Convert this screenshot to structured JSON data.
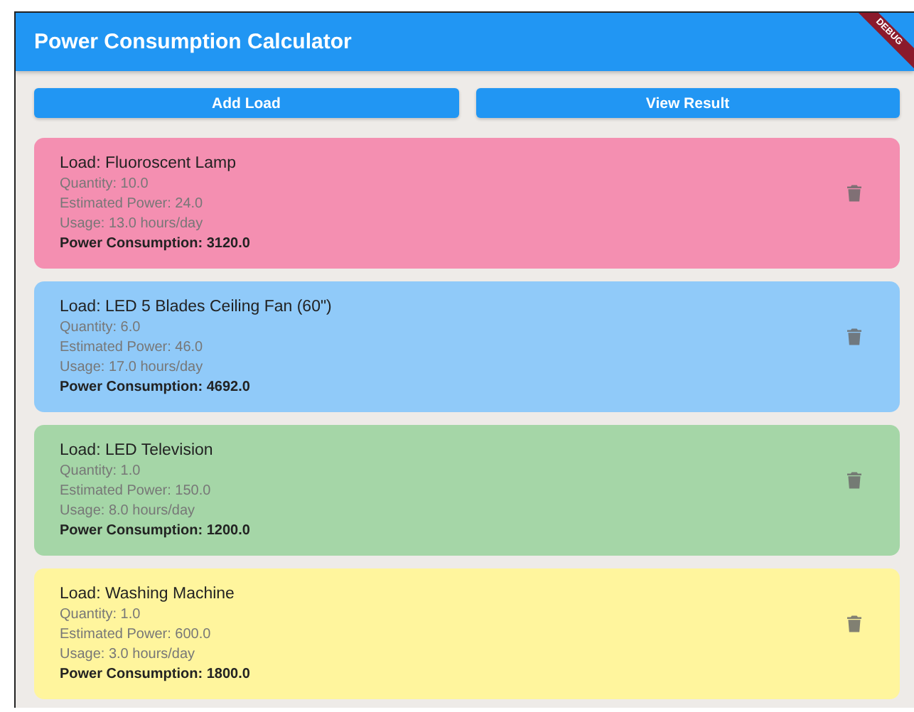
{
  "app_bar": {
    "title": "Power Consumption Calculator",
    "debug_banner": "DEBUG"
  },
  "buttons": [
    "Add Load",
    "View Result"
  ],
  "loads": [
    {
      "title": "Load: Fluoroscent Lamp",
      "quantity": "Quantity: 10.0",
      "estimated_power": "Estimated Power: 24.0",
      "usage": "Usage: 13.0 hours/day",
      "consumption": "Power Consumption: 3120.0",
      "color": "#f48fb1"
    },
    {
      "title": "Load: LED 5 Blades Ceiling Fan (60\")",
      "quantity": "Quantity: 6.0",
      "estimated_power": "Estimated Power: 46.0",
      "usage": "Usage: 17.0 hours/day",
      "consumption": "Power Consumption: 4692.0",
      "color": "#90caf9"
    },
    {
      "title": "Load: LED Television",
      "quantity": "Quantity: 1.0",
      "estimated_power": "Estimated Power: 150.0",
      "usage": "Usage: 8.0 hours/day",
      "consumption": "Power Consumption: 1200.0",
      "color": "#a5d6a7"
    },
    {
      "title": "Load: Washing Machine",
      "quantity": "Quantity: 1.0",
      "estimated_power": "Estimated Power: 600.0",
      "usage": "Usage: 3.0 hours/day",
      "consumption": "Power Consumption: 1800.0",
      "color": "#fff59d"
    }
  ]
}
